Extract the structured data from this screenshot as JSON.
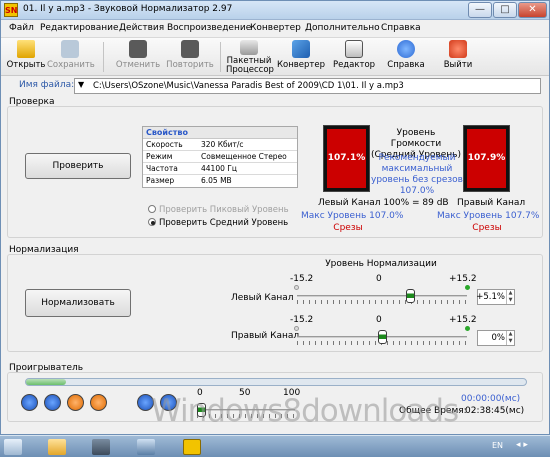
{
  "window": {
    "title": "01. Il y a.mp3 - Звуковой Нормализатор 2.97",
    "logo_text": "SN",
    "minimize_glyph": "—",
    "maximize_glyph": "□",
    "close_glyph": "✕"
  },
  "menu": [
    "Файл",
    "Редактирование",
    "Действия",
    "Воспроизведение",
    "Конвертер",
    "Дополнительно",
    "Справка"
  ],
  "toolbar": [
    {
      "label": "Открыть",
      "icon": "open-folder-icon",
      "enabled": true
    },
    {
      "label": "Сохранить",
      "icon": "save-icon",
      "enabled": false
    },
    {
      "label": "Отменить",
      "icon": "undo-icon",
      "enabled": false
    },
    {
      "label": "Повторить",
      "icon": "redo-icon",
      "enabled": false
    },
    {
      "label": "Пакетный Процессор",
      "icon": "batch-processor-icon",
      "enabled": true
    },
    {
      "label": "Конвертер",
      "icon": "converter-icon",
      "enabled": true
    },
    {
      "label": "Редактор",
      "icon": "editor-icon",
      "enabled": true
    },
    {
      "label": "Справка",
      "icon": "help-icon",
      "enabled": true
    },
    {
      "label": "Выйти",
      "icon": "power-icon",
      "enabled": true
    }
  ],
  "file": {
    "label": "Имя файла:",
    "path": "C:\\Users\\OSzone\\Music\\Vanessa Paradis Best of 2009\\CD 1\\01. Il y a.mp3"
  },
  "check": {
    "title": "Проверка",
    "button": "Проверить",
    "properties_header": "Свойство",
    "properties": [
      {
        "key": "Скорость",
        "value": "320 Кбит/с"
      },
      {
        "key": "Режим",
        "value": "Совмещенное Стерео"
      },
      {
        "key": "Частота",
        "value": "44100 Гц"
      },
      {
        "key": "Размер",
        "value": "6.05 MB"
      }
    ],
    "radio_peak": "Проверить Пиковый Уровень",
    "radio_average": "Проверить Средний Уровень",
    "selected_radio": "average",
    "left_meter": {
      "value": "107.1%",
      "level": 1.0,
      "channel": "Левый Канал",
      "max": "Макс Уровень 107.0%",
      "clips": "Срезы"
    },
    "right_meter": {
      "value": "107.9%",
      "level": 1.0,
      "channel": "Правый Канал",
      "max": "Макс Уровень 107.7%",
      "clips": "Срезы"
    },
    "loudness_title": "Уровень Громкости (Средний Уровень)",
    "recommended": "Рекомендуемый максимальный уровень без срезов 107.0%",
    "db_line": "100% = 89 dB"
  },
  "normalization": {
    "title": "Нормализация",
    "button": "Нормализовать",
    "level_title": "Уровень Нормализации",
    "min_label": "-15.2",
    "mid_label": "0",
    "max_label": "+15.2",
    "left": {
      "label": "Левый Канал",
      "value": "+5.1%",
      "position": 0.68
    },
    "right": {
      "label": "Правый Канал",
      "value": "0%",
      "position": 0.5
    }
  },
  "player": {
    "title": "Проигрыватель",
    "progress": 0.08,
    "volume_ticks": [
      "0",
      "50",
      "100"
    ],
    "volume": 0.0,
    "time": "00:00:00(мс)",
    "total_label": "Общее Время:",
    "total_time": "02:38:45(мс)"
  },
  "taskbar": {
    "language": "EN",
    "arrows": "◂ ▸"
  },
  "watermark": "Windows8downloads",
  "colors": {
    "meter_red": "#cc0000",
    "accent_blue": "#3a5fd0",
    "slider_green": "#1c8a1c"
  }
}
